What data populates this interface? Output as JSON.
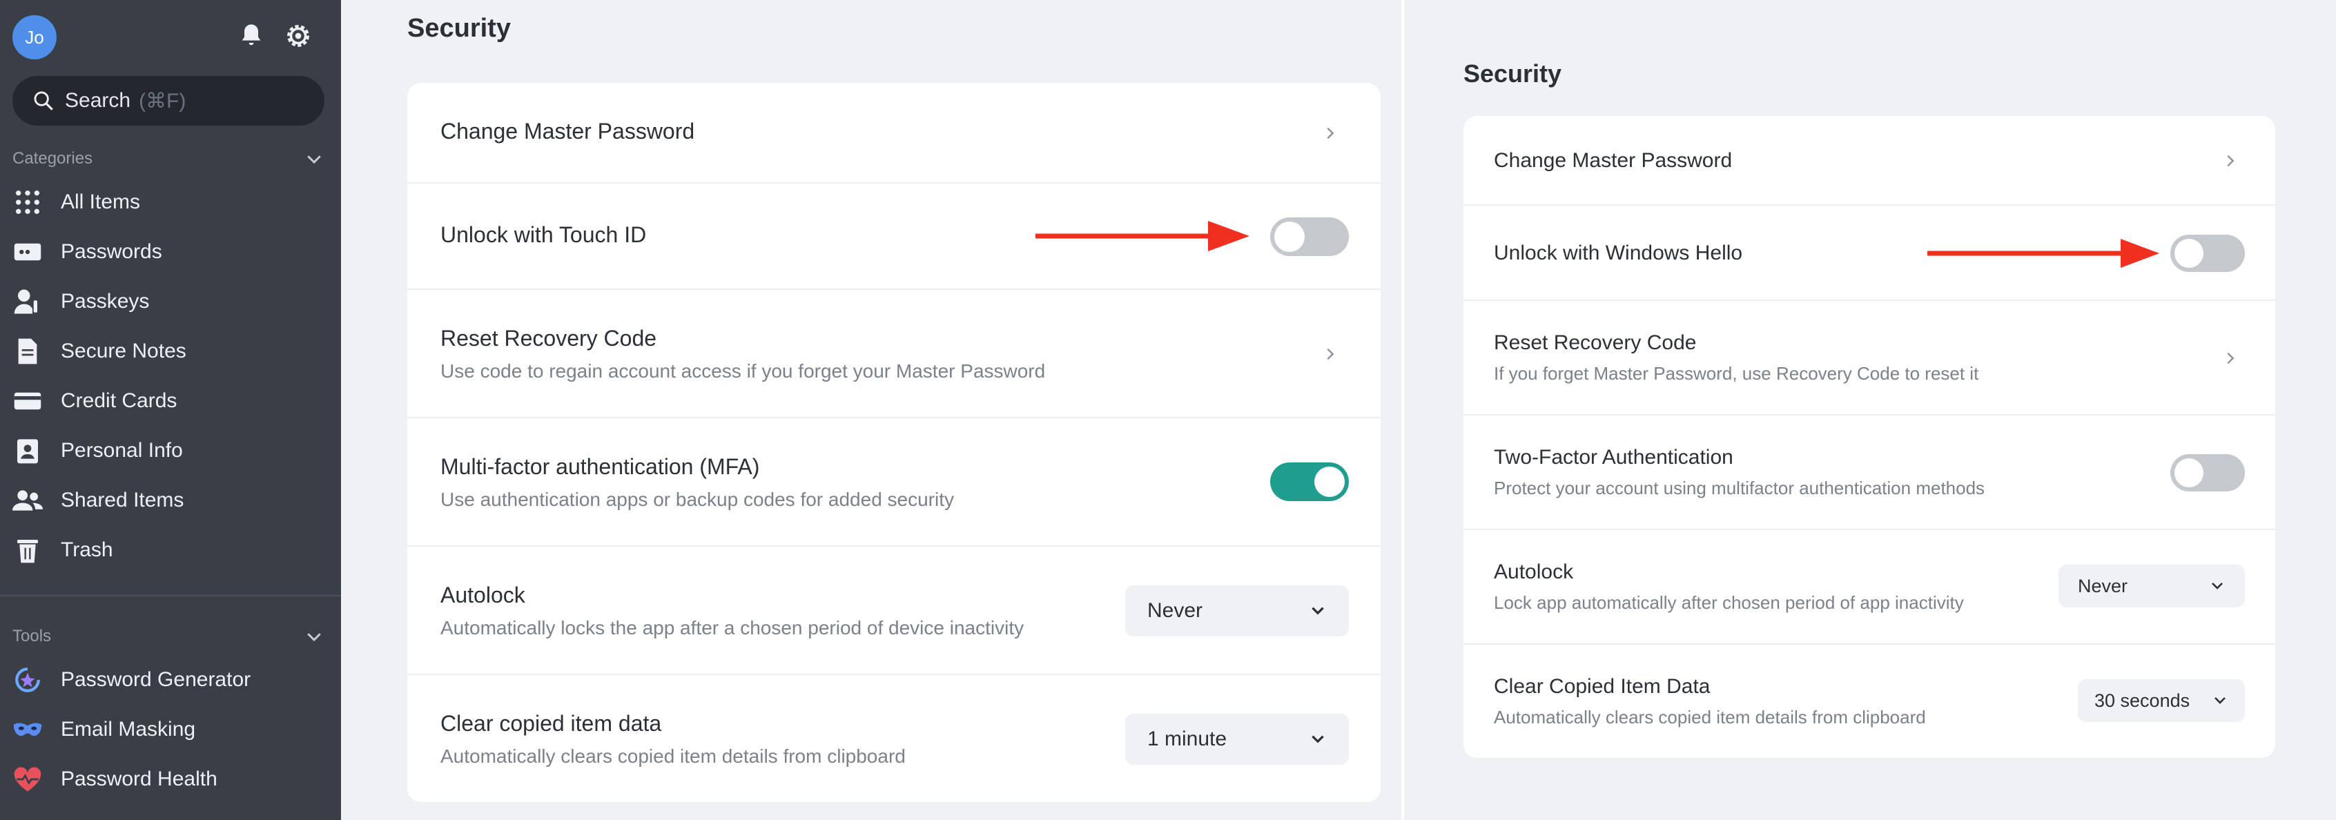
{
  "sidebar": {
    "avatar_initials": "Jo",
    "search": {
      "label": "Search",
      "shortcut": "(⌘F)"
    },
    "categories_label": "Categories",
    "tools_label": "Tools",
    "categories": [
      {
        "label": "All Items",
        "icon": "grid-icon"
      },
      {
        "label": "Passwords",
        "icon": "password-card-icon"
      },
      {
        "label": "Passkeys",
        "icon": "passkey-user-icon"
      },
      {
        "label": "Secure Notes",
        "icon": "note-icon"
      },
      {
        "label": "Credit Cards",
        "icon": "credit-card-icon"
      },
      {
        "label": "Personal Info",
        "icon": "id-badge-icon"
      },
      {
        "label": "Shared Items",
        "icon": "users-icon"
      },
      {
        "label": "Trash",
        "icon": "trash-icon"
      }
    ],
    "tools": [
      {
        "label": "Password Generator",
        "icon": "generator-icon"
      },
      {
        "label": "Email Masking",
        "icon": "mask-icon"
      },
      {
        "label": "Password Health",
        "icon": "heart-pulse-icon"
      }
    ]
  },
  "left": {
    "title": "Security",
    "rows": [
      {
        "label": "Change Master Password"
      },
      {
        "label": "Unlock with Touch ID",
        "toggle": false
      },
      {
        "label": "Reset Recovery Code",
        "sub": "Use code to regain account access if you forget your Master Password"
      },
      {
        "label": "Multi-factor authentication (MFA)",
        "sub": "Use authentication apps or backup codes for added security",
        "toggle": true
      },
      {
        "label": "Autolock",
        "sub": "Automatically locks the app after a chosen period of device inactivity",
        "value": "Never"
      },
      {
        "label": "Clear copied item data",
        "sub": "Automatically clears copied item details from clipboard",
        "value": "1 minute"
      }
    ]
  },
  "right": {
    "title": "Security",
    "rows": [
      {
        "label": "Change Master Password"
      },
      {
        "label": "Unlock with Windows Hello",
        "toggle": false
      },
      {
        "label": "Reset Recovery Code",
        "sub": "If you forget Master Password, use Recovery Code to reset it"
      },
      {
        "label": "Two-Factor Authentication",
        "sub": "Protect your account using multifactor authentication methods",
        "toggle": false
      },
      {
        "label": "Autolock",
        "sub": "Lock app automatically after chosen period of app inactivity",
        "value": "Never"
      },
      {
        "label": "Clear Copied Item Data",
        "sub": "Automatically clears copied item details from clipboard",
        "value": "30 seconds"
      }
    ]
  },
  "colors": {
    "sidebar_bg": "#3a3e47",
    "toggle_on": "#1f9e8f",
    "toggle_off": "#c5c8cd",
    "annotation_arrow": "#f0301e",
    "avatar": "#4f8fea"
  }
}
